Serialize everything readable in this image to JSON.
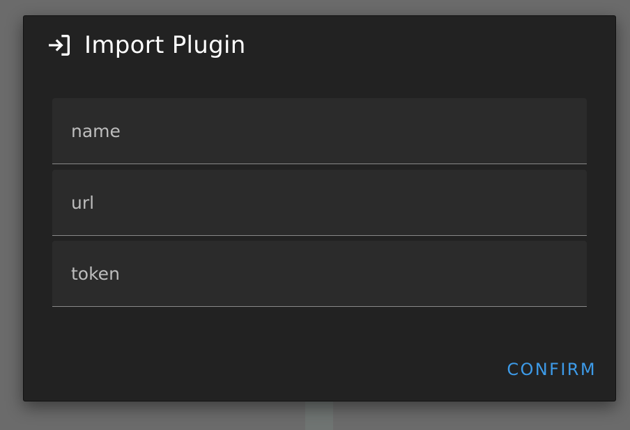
{
  "dialog": {
    "title": "Import Plugin",
    "icon": "import-icon"
  },
  "fields": {
    "name": {
      "placeholder": "name",
      "value": ""
    },
    "url": {
      "placeholder": "url",
      "value": ""
    },
    "token": {
      "placeholder": "token",
      "value": ""
    }
  },
  "actions": {
    "confirm_label": "CONFIRM"
  },
  "colors": {
    "accent": "#3d9be9",
    "dialog_bg": "#222222",
    "field_bg": "#2b2b2b",
    "backdrop": "#6b6b6b"
  }
}
